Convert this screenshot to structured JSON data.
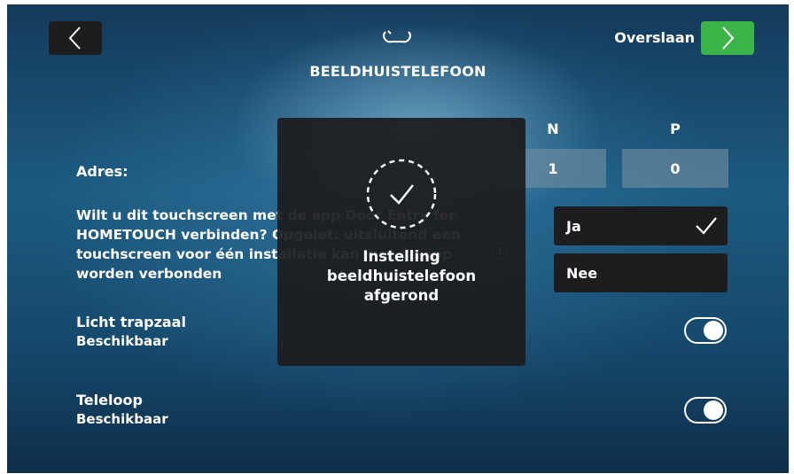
{
  "header": {
    "title": "BEELDHUISTELEFOON",
    "skip_label": "Overslaan",
    "back_icon": "chevron-left-icon",
    "next_icon": "chevron-right-icon",
    "header_icon": "handset-icon",
    "next_color": "#3cb44a"
  },
  "address": {
    "label": "Adres:",
    "columns": [
      {
        "header": "N",
        "value": "1"
      },
      {
        "header": "P",
        "value": "0"
      }
    ]
  },
  "app_question": {
    "text": "Wilt u dit touchscreen met de app Door Entry for HOMETOUCH verbinden? Opgelet: uitsluitend een touchscreen voor één installatie kan met de app worden verbonden",
    "info_icon": "info-icon",
    "options": [
      {
        "label": "Ja",
        "selected": true
      },
      {
        "label": "Nee",
        "selected": false
      }
    ]
  },
  "settings": [
    {
      "title": "Licht trapzaal",
      "subtitle": "Beschikbaar",
      "enabled": true
    },
    {
      "title": "Teleloop",
      "subtitle": "Beschikbaar",
      "enabled": true
    }
  ],
  "modal": {
    "icon": "dashed-circle-check-icon",
    "message": "Instelling\nbeeldhuistelefoon\nafgerond"
  }
}
